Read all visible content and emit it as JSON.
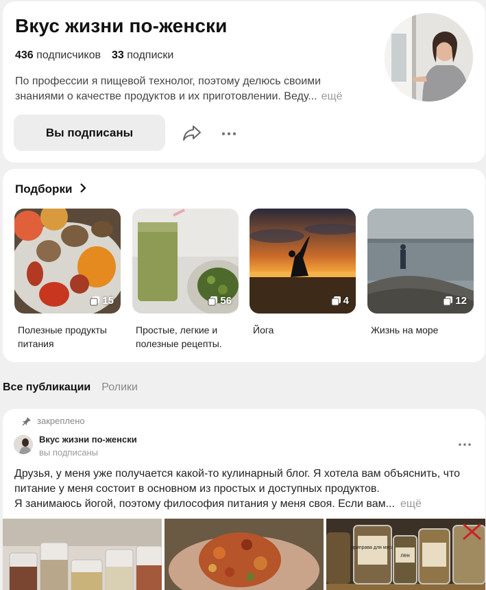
{
  "profile": {
    "title": "Вкус жизни по-женски",
    "subscribers_count": "436",
    "subscribers_label": "подписчиков",
    "subscriptions_count": "33",
    "subscriptions_label": "подписки",
    "description_line1": "По профессии я пищевой технолог, поэтому делюсь своими",
    "description_line2": "знаниями о качестве продуктов и их приготовлении. Веду...",
    "more_label": "ещё",
    "subscribed_button": "Вы подписаны",
    "avatar_icon": "profile-photo-woman"
  },
  "collections": {
    "title": "Подборки",
    "items": [
      {
        "name_line1": "Полезные продукты",
        "name_line2": "питания",
        "count": "15"
      },
      {
        "name_line1": "Простые, легкие и",
        "name_line2": "полезные рецепты.",
        "count": "56"
      },
      {
        "name_line1": "Йога",
        "name_line2": "",
        "count": "4"
      },
      {
        "name_line1": "Жизнь на море",
        "name_line2": "",
        "count": "12"
      }
    ]
  },
  "tabs": {
    "all": "Все публикации",
    "reels": "Ролики"
  },
  "post": {
    "pinned_label": "закреплено",
    "author": "Вкус жизни по-женски",
    "author_status": "вы подписаны",
    "text_line1": "Друзья, у меня уже получается какой-то кулинарный блог. Я хотела вам объяснить, что",
    "text_line2": "питание у меня состоит в основном из простых и доступных продуктов.",
    "text_line3": "Я занимаюсь йогой, поэтому философия питания у меня своя. Если вам...",
    "more_label": "ещё",
    "jar_label_1": "приправа для мяса",
    "jar_label_2": "лен"
  },
  "colors": {
    "background": "#f0f0f1",
    "card": "#ffffff",
    "button_bg": "#ededee",
    "muted_text": "#999999"
  }
}
